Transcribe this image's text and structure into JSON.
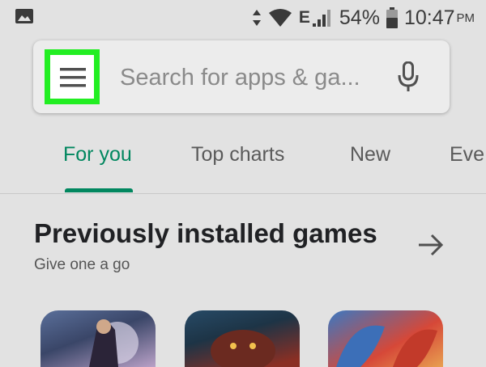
{
  "status_bar": {
    "network_type": "E",
    "battery": "54%",
    "time": "10:47",
    "time_suffix": "PM",
    "icons": [
      "image-icon",
      "data-arrows-icon",
      "wifi-icon",
      "signal-icon",
      "battery-icon"
    ]
  },
  "search": {
    "placeholder": "Search for apps & ga...",
    "menu_icon": "hamburger-menu-icon",
    "mic_icon": "microphone-icon",
    "highlight_color": "#22ee22"
  },
  "tabs": [
    {
      "label": "For you",
      "active": true
    },
    {
      "label": "Top charts",
      "active": false
    },
    {
      "label": "New",
      "active": false
    },
    {
      "label": "Eve",
      "active": false
    }
  ],
  "section": {
    "title": "Previously installed games",
    "subtitle": "Give one a go",
    "arrow_icon": "arrow-right-icon"
  },
  "colors": {
    "accent": "#01875f",
    "background": "#e2e2e2"
  }
}
